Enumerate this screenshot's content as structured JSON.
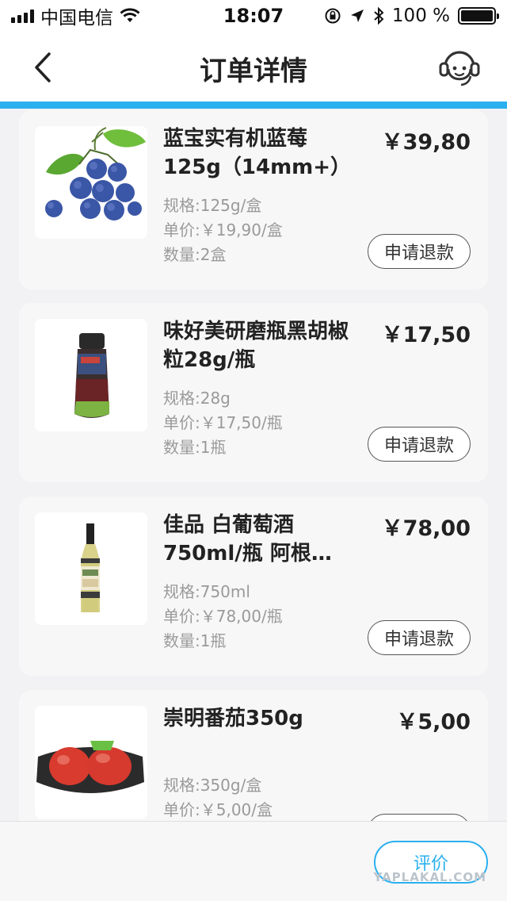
{
  "status_bar": {
    "carrier": "中国电信",
    "time": "18:07",
    "battery": "100 %",
    "battery_level": 1.0
  },
  "header": {
    "title": "订单详情",
    "back_icon": "chevron-left-icon",
    "service_icon": "customer-service-icon"
  },
  "colors": {
    "accent": "#2ab0ee",
    "card_bg": "#f7f7f7",
    "meta_text": "#9a9a9a"
  },
  "items": [
    {
      "name": "蓝宝实有机蓝莓125g（14mm+）",
      "price": "￥39,80",
      "spec": "规格:125g/盒",
      "unit_price": "单价:￥19,90/盒",
      "quantity": "数量:2盒",
      "action": "申请退款",
      "image": "blueberries"
    },
    {
      "name": "味好美研磨瓶黑胡椒粒28g/瓶",
      "price": "￥17,50",
      "spec": "规格:28g",
      "unit_price": "单价:￥17,50/瓶",
      "quantity": "数量:1瓶",
      "action": "申请退款",
      "image": "pepper-grinder"
    },
    {
      "name": "佳品 白葡萄酒750ml/瓶 阿根…",
      "price": "￥78,00",
      "spec": "规格:750ml",
      "unit_price": "单价:￥78,00/瓶",
      "quantity": "数量:1瓶",
      "action": "申请退款",
      "image": "white-wine-bottle"
    },
    {
      "name": "崇明番茄350g",
      "price": "￥5,00",
      "spec": "规格:350g/盒",
      "unit_price": "单价:￥5,00/盒",
      "image": "tomatoes-pack"
    }
  ],
  "footer": {
    "review_label": "评价",
    "watermark": "YAPLAKAL.COM"
  }
}
